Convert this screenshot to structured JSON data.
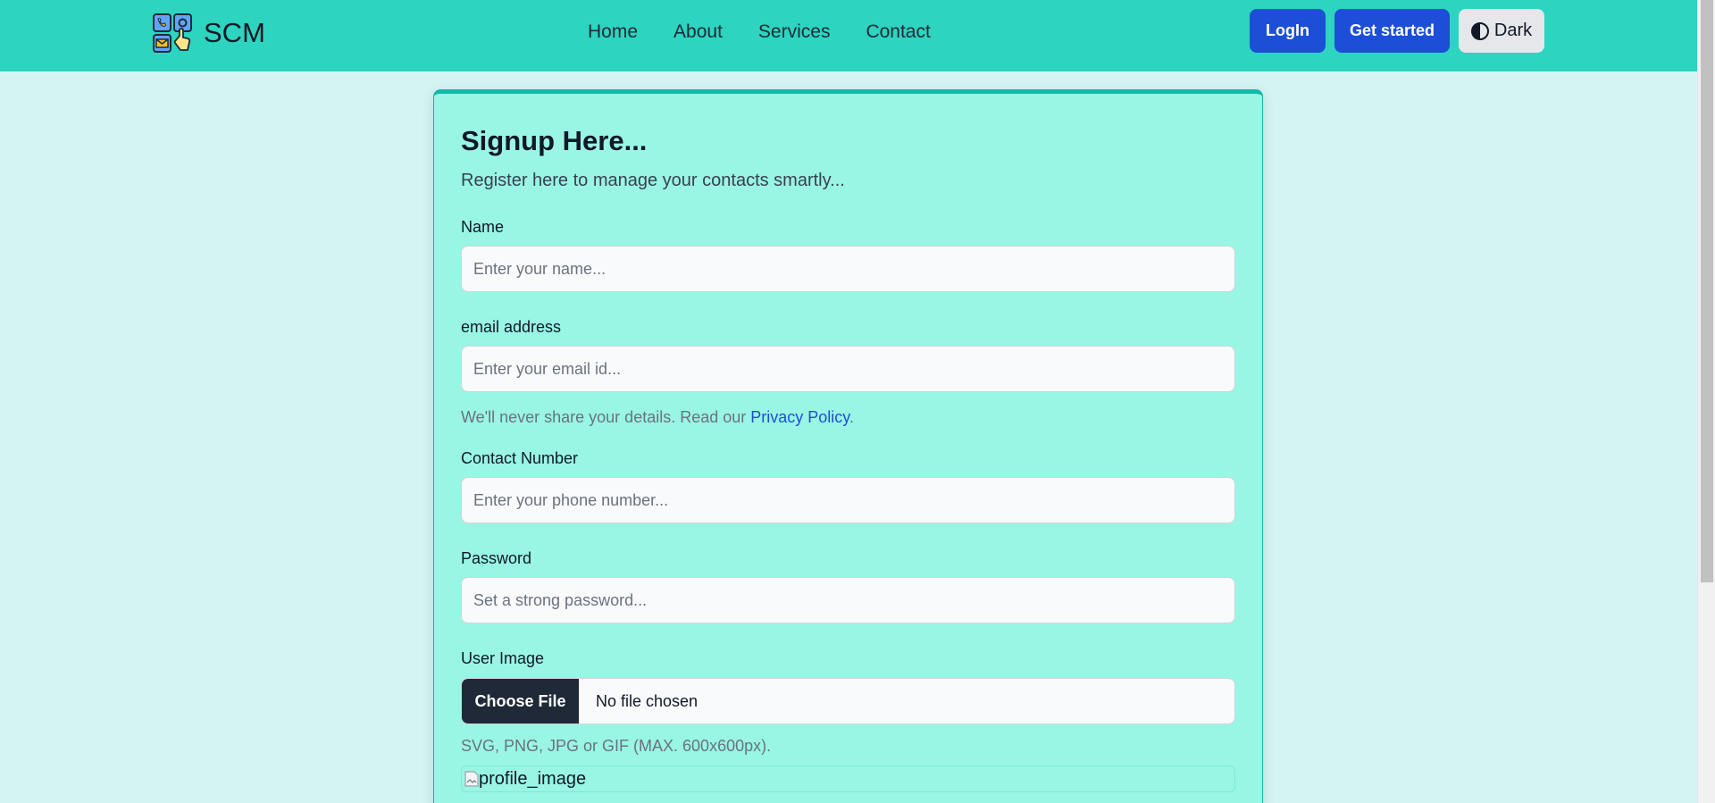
{
  "nav": {
    "brand": "SCM",
    "links": [
      "Home",
      "About",
      "Services",
      "Contact"
    ],
    "login_label": "LogIn",
    "get_started_label": "Get started",
    "theme_label": "Dark"
  },
  "form": {
    "title": "Signup Here...",
    "subtitle": "Register here to manage your contacts smartly...",
    "name": {
      "label": "Name",
      "placeholder": "Enter your name..."
    },
    "email": {
      "label": "email address",
      "placeholder": "Enter your email id...",
      "help_prefix": "We'll never share your details. Read our ",
      "help_link": "Privacy Policy",
      "help_suffix": "."
    },
    "phone": {
      "label": "Contact Number",
      "placeholder": "Enter your phone number..."
    },
    "password": {
      "label": "Password",
      "placeholder": "Set a strong password..."
    },
    "image": {
      "label": "User Image",
      "choose_label": "Choose File",
      "status": "No file chosen",
      "help": "SVG, PNG, JPG or GIF (MAX. 600x600px).",
      "preview_alt": "profile_image"
    }
  },
  "colors": {
    "navbar": "#2dd4bf",
    "page_bg": "#d4f4f4",
    "card_bg": "#99f6e4",
    "primary": "#1d4ed8"
  }
}
